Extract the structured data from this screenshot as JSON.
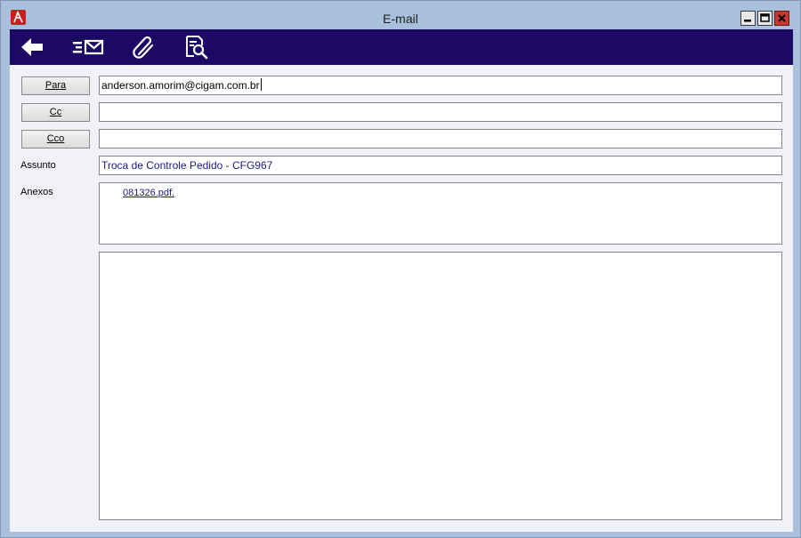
{
  "window": {
    "title": "E-mail",
    "icons": [
      "app-icon",
      "minimize-icon",
      "maximize-icon",
      "close-icon"
    ]
  },
  "toolbar": {
    "icons": [
      "back-arrow-icon",
      "mail-list-icon",
      "paperclip-icon",
      "document-search-icon"
    ]
  },
  "form": {
    "para_label": "Para",
    "cc_label": "Cc",
    "cco_label": "Cco",
    "para_value": "anderson.amorim@cigam.com.br",
    "cc_value": "",
    "cco_value": "",
    "assunto_label": "Assunto",
    "assunto_value": "Troca de Controle Pedido - CFG967",
    "anexos_label": "Anexos",
    "attachments": [
      "081326.pdf."
    ],
    "body_text": ""
  },
  "colors": {
    "toolbar_bg": "#1c0966",
    "window_frame": "#a9c0dc",
    "content_bg": "#f0f2f7",
    "subject_text": "#1c1a80",
    "close_button": "#c8372b"
  }
}
